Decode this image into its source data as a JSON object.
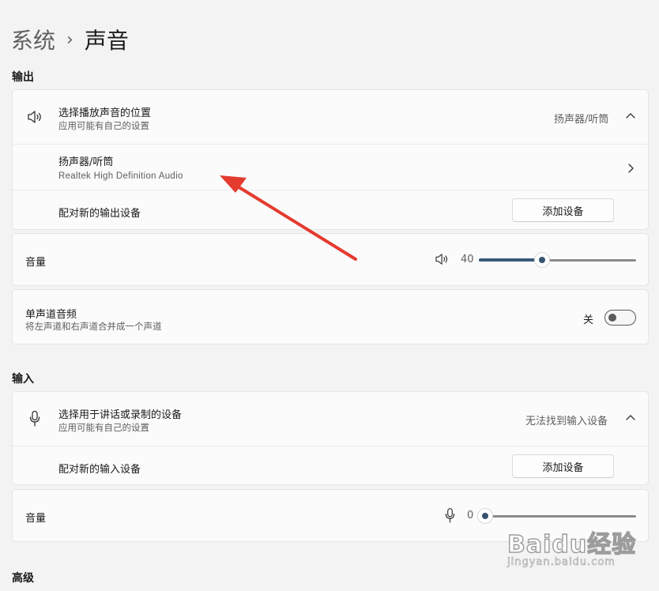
{
  "breadcrumb": {
    "parent": "系统",
    "separator": "›",
    "current": "声音"
  },
  "output": {
    "section_title": "输出",
    "choose_output": {
      "title": "选择播放声音的位置",
      "subtitle": "应用可能有自己的设置",
      "selected": "扬声器/听筒",
      "icon": "speaker-icon"
    },
    "device": {
      "name": "扬声器/听筒",
      "driver": "Realtek High Definition Audio"
    },
    "pair": {
      "label": "配对新的输出设备",
      "button": "添加设备"
    },
    "volume": {
      "label": "音量",
      "value": "40",
      "level": 0.4
    },
    "mono": {
      "title": "单声道音频",
      "subtitle": "将左声道和右声道合并成一个声道",
      "state_label": "关",
      "on": false
    }
  },
  "input": {
    "section_title": "输入",
    "choose_input": {
      "title": "选择用于讲话或录制的设备",
      "subtitle": "应用可能有自己的设置",
      "selected": "无法找到输入设备",
      "icon": "microphone-icon"
    },
    "pair": {
      "label": "配对新的输入设备",
      "button": "添加设备"
    },
    "volume": {
      "label": "音量",
      "value": "0",
      "level": 0
    }
  },
  "advanced": {
    "section_title": "高级"
  },
  "annotation": {
    "color": "#e53a2e"
  },
  "watermark": {
    "logo": "Baidu经验",
    "url": "jingyan.baidu.com"
  },
  "colors": {
    "accent": "#36536f",
    "background": "#f3f3f3",
    "card": "#fbfbfb"
  }
}
